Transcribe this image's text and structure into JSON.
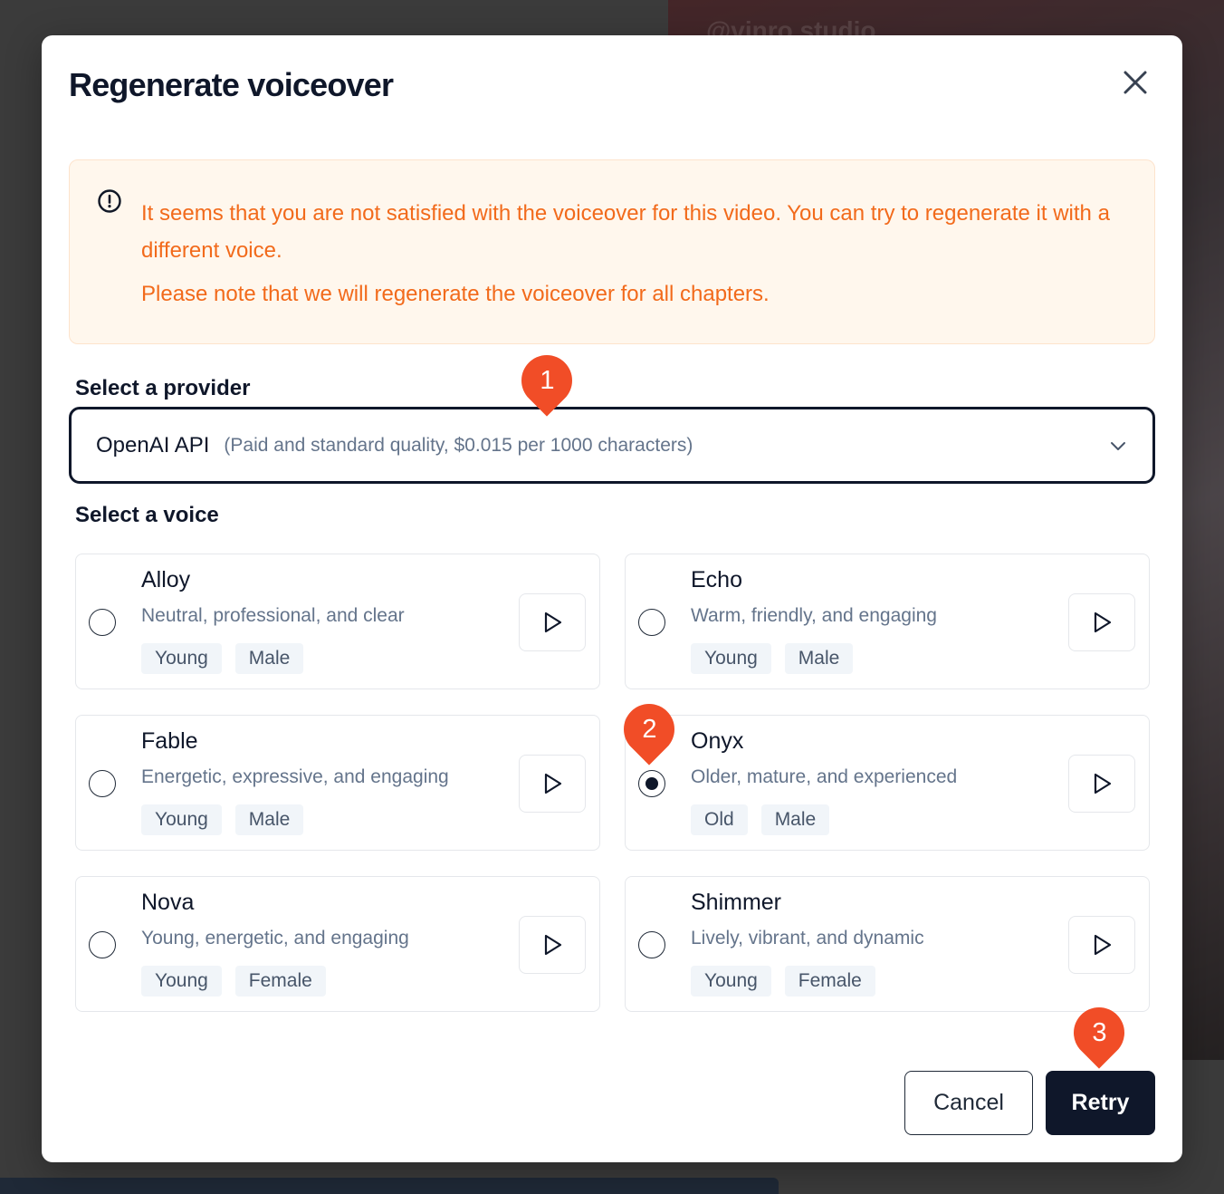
{
  "backdrop": {
    "watermark": "@vinro studio"
  },
  "dialog": {
    "title": "Regenerate voiceover",
    "close_icon": "close-icon"
  },
  "warning": {
    "icon": "alert-circle-icon",
    "line1": "It seems that you are not satisfied with the voiceover for this video. You can try to regenerate it with a different voice.",
    "line2": "Please note that we will regenerate the voiceover for all chapters.",
    "text_color": "#f26a1b",
    "bg_color": "#fff7ed"
  },
  "provider": {
    "label": "Select a provider",
    "selected_name": "OpenAI API",
    "selected_desc": "(Paid and standard quality, $0.015 per 1000 characters)",
    "chevron_icon": "chevron-down-icon"
  },
  "voice": {
    "label": "Select a voice",
    "selected": "Onyx",
    "options": [
      {
        "name": "Alloy",
        "desc": "Neutral, professional, and clear",
        "tags": [
          "Young",
          "Male"
        ],
        "selected": false
      },
      {
        "name": "Echo",
        "desc": "Warm, friendly, and engaging",
        "tags": [
          "Young",
          "Male"
        ],
        "selected": false
      },
      {
        "name": "Fable",
        "desc": "Energetic, expressive, and engaging",
        "tags": [
          "Young",
          "Male"
        ],
        "selected": false
      },
      {
        "name": "Onyx",
        "desc": "Older, mature, and experienced",
        "tags": [
          "Old",
          "Male"
        ],
        "selected": true
      },
      {
        "name": "Nova",
        "desc": "Young, energetic, and engaging",
        "tags": [
          "Young",
          "Female"
        ],
        "selected": false
      },
      {
        "name": "Shimmer",
        "desc": "Lively, vibrant, and dynamic",
        "tags": [
          "Young",
          "Female"
        ],
        "selected": false
      }
    ]
  },
  "actions": {
    "cancel_label": "Cancel",
    "retry_label": "Retry",
    "primary_color": "#0f172a"
  },
  "markers": [
    "1",
    "2",
    "3"
  ],
  "marker_color": "#f14d27"
}
